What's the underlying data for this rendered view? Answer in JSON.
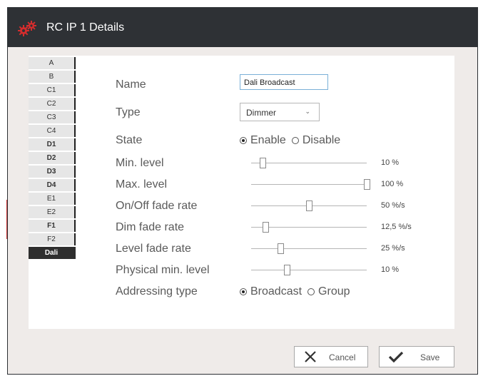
{
  "window": {
    "title": "RC IP 1 Details",
    "icon": "gears-icon",
    "accent": "#d42d2d"
  },
  "tabs": [
    "A",
    "B",
    "C1",
    "C2",
    "C3",
    "C4",
    "D1",
    "D2",
    "D3",
    "D4",
    "E1",
    "E2",
    "F1",
    "F2",
    "Dali"
  ],
  "active_tab": "Dali",
  "form": {
    "name_label": "Name",
    "name_value": "Dali Broadcast",
    "type_label": "Type",
    "type_value": "Dimmer",
    "state_label": "State",
    "state_options": [
      "Enable",
      "Disable"
    ],
    "state_selected": "Enable",
    "addressing_label": "Addressing type",
    "addressing_options": [
      "Broadcast",
      "Group"
    ],
    "addressing_selected": "Broadcast"
  },
  "sliders": [
    {
      "label": "Min. level",
      "value": "10 %",
      "fraction": 0.1
    },
    {
      "label": "Max. level",
      "value": "100 %",
      "fraction": 1.0
    },
    {
      "label": "On/Off fade rate",
      "value": "50 %/s",
      "fraction": 0.5
    },
    {
      "label": "Dim fade rate",
      "value": "12,5 %/s",
      "fraction": 0.125
    },
    {
      "label": "Level fade rate",
      "value": "25 %/s",
      "fraction": 0.25
    },
    {
      "label": "Physical min. level",
      "value": "10 %",
      "fraction": 0.31
    }
  ],
  "buttons": {
    "cancel": "Cancel",
    "save": "Save"
  }
}
